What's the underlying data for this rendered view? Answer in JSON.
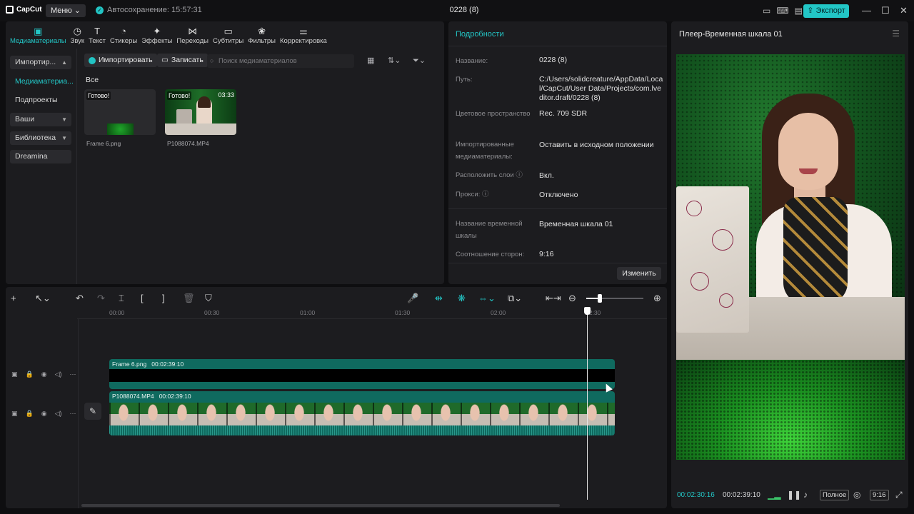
{
  "app": {
    "logo_text": "CapCut",
    "menu_label": "Меню",
    "autosave_text": "Автосохранение: 15:57:31",
    "document_title": "0228 (8)",
    "export_label": "Экспорт",
    "accent_color": "#22c6c6"
  },
  "toolbar": {
    "tools": [
      {
        "label": "Медиаматериалы",
        "icon": "media-icon"
      },
      {
        "label": "Звук",
        "icon": "audio-icon"
      },
      {
        "label": "Текст",
        "icon": "text-icon"
      },
      {
        "label": "Стикеры",
        "icon": "sticker-icon"
      },
      {
        "label": "Эффекты",
        "icon": "effects-icon"
      },
      {
        "label": "Переходы",
        "icon": "transitions-icon"
      },
      {
        "label": "Субтитры",
        "icon": "subtitles-icon"
      },
      {
        "label": "Фильтры",
        "icon": "filters-icon"
      },
      {
        "label": "Корректировка",
        "icon": "adjust-icon"
      }
    ]
  },
  "sidebar": {
    "items": [
      {
        "label": "Импортир..."
      },
      {
        "label": "Медиаматериа..."
      },
      {
        "label": "Подпроекты"
      },
      {
        "label": "Ваши"
      },
      {
        "label": "Библиотека"
      },
      {
        "label": "Dreamina"
      }
    ]
  },
  "media": {
    "import_label": "Импортировать",
    "record_label": "Записать",
    "search_placeholder": "Поиск медиаматериалов",
    "filter_label": "Все",
    "items": [
      {
        "name": "Frame 6.png",
        "status": "Готово!",
        "duration": ""
      },
      {
        "name": "P1088074.MP4",
        "status": "Готово!",
        "duration": "03:33"
      }
    ]
  },
  "details": {
    "title": "Подробности",
    "rows": [
      {
        "label": "Название:",
        "value": "0228 (8)"
      },
      {
        "label": "Путь:",
        "value": "C:/Users/solidcreature/AppData/Local/CapCut/User Data/Projects/com.lveditor.draft/0228 (8)"
      },
      {
        "label": "Цветовое пространство",
        "value": "Rec. 709 SDR"
      },
      {
        "label": "Импортированные медиаматериалы:",
        "value": "Оставить в исходном положении"
      },
      {
        "label": "Расположить слои",
        "value": "Вкл."
      },
      {
        "label": "Прокси:",
        "value": "Отключено"
      },
      {
        "label": "Название временной шкалы",
        "value": "Временная шкала 01"
      },
      {
        "label": "Соотношение сторон:",
        "value": "9:16"
      }
    ],
    "edit_label": "Изменить"
  },
  "player": {
    "title": "Плеер-Временная шкала 01",
    "current_time": "00:02:30:16",
    "total_time": "00:02:39:10",
    "full_label": "Полное",
    "ratio_label": "9:16"
  },
  "timeline": {
    "ruler": [
      "00:00",
      "00:30",
      "01:00",
      "01:30",
      "02:00",
      "02:30"
    ],
    "clips": [
      {
        "name": "Frame 6.png",
        "duration": "00:02:39:10"
      },
      {
        "name": "P1088074.MP4",
        "duration": "00:02:39:10"
      }
    ]
  }
}
